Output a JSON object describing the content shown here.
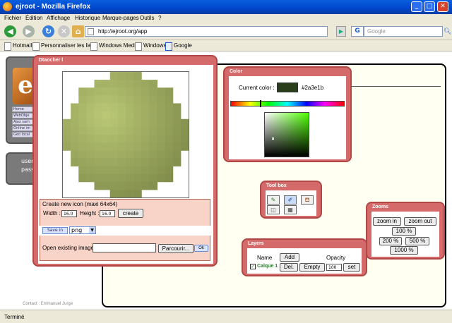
{
  "window": {
    "title": "ejroot - Mozilla Firefox"
  },
  "menu": {
    "items": [
      "Fichier",
      "Édition",
      "Affichage",
      "Historique",
      "Marque-pages",
      "Outils",
      "?"
    ]
  },
  "nav": {
    "url": "http://ejroot.org/app",
    "search_placeholder": "Google"
  },
  "bookmarks": {
    "items": [
      "Hotmail",
      "Personnaliser les liens",
      "Windows Media",
      "Windows",
      "Google"
    ]
  },
  "background": {
    "logo_letter": "e",
    "links": [
      "Home",
      "WebObje",
      "Ajax sam",
      "Online im",
      "Geo local"
    ],
    "login_lines": [
      "user",
      "pass"
    ],
    "contact": "Contact : Emmanuel Jurge"
  },
  "editor": {
    "title": "Dtaocher l",
    "create_title": "Create new icon (maxi 64x64)",
    "width_label": "Width :",
    "width_value": "16.0",
    "height_label": "Height :",
    "height_value": "16.0",
    "create_button": "create",
    "save_button": "Save in",
    "format_value": "png",
    "open_label": "Open existing image",
    "browse_button": "Parcourir...",
    "ok_button": "Ok"
  },
  "color": {
    "title": "Color",
    "current_label": "Current color :",
    "current_hex": "#2a3e1b",
    "swatch_color": "#2a3e1b"
  },
  "toolbox": {
    "title": "Tool box"
  },
  "zooms": {
    "title": "Zooms",
    "zoom_in": "zoom in",
    "zoom_out": "zoom out",
    "z100": "100 %",
    "z200": "200 %",
    "z500": "500 %",
    "z1000": "1000 %"
  },
  "layers": {
    "title": "Layers",
    "name_header": "Name",
    "add_button": "Add",
    "opacity_header": "Opacity",
    "layer_name": "Calque 1",
    "del_button": "Del.",
    "empty_button": "Empty",
    "opacity_value": "100",
    "set_button": "set"
  },
  "status": {
    "text": "Terminé"
  }
}
